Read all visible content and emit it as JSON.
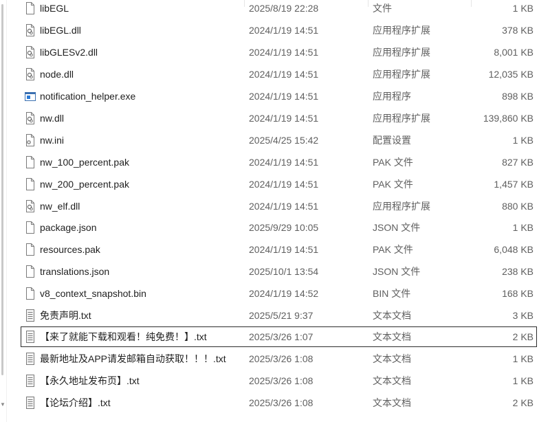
{
  "files": [
    {
      "name": "libEGL",
      "date": "2025/8/19 22:28",
      "type": "文件",
      "size": "1 KB",
      "icon": "blank-file-icon"
    },
    {
      "name": "libEGL.dll",
      "date": "2024/1/19 14:51",
      "type": "应用程序扩展",
      "size": "378 KB",
      "icon": "dll-file-icon"
    },
    {
      "name": "libGLESv2.dll",
      "date": "2024/1/19 14:51",
      "type": "应用程序扩展",
      "size": "8,001 KB",
      "icon": "dll-file-icon"
    },
    {
      "name": "node.dll",
      "date": "2024/1/19 14:51",
      "type": "应用程序扩展",
      "size": "12,035 KB",
      "icon": "dll-file-icon"
    },
    {
      "name": "notification_helper.exe",
      "date": "2024/1/19 14:51",
      "type": "应用程序",
      "size": "898 KB",
      "icon": "exe-file-icon"
    },
    {
      "name": "nw.dll",
      "date": "2024/1/19 14:51",
      "type": "应用程序扩展",
      "size": "139,860 KB",
      "icon": "dll-file-icon"
    },
    {
      "name": "nw.ini",
      "date": "2025/4/25 15:42",
      "type": "配置设置",
      "size": "1 KB",
      "icon": "ini-file-icon"
    },
    {
      "name": "nw_100_percent.pak",
      "date": "2024/1/19 14:51",
      "type": "PAK 文件",
      "size": "827 KB",
      "icon": "blank-file-icon"
    },
    {
      "name": "nw_200_percent.pak",
      "date": "2024/1/19 14:51",
      "type": "PAK 文件",
      "size": "1,457 KB",
      "icon": "blank-file-icon"
    },
    {
      "name": "nw_elf.dll",
      "date": "2024/1/19 14:51",
      "type": "应用程序扩展",
      "size": "880 KB",
      "icon": "dll-file-icon"
    },
    {
      "name": "package.json",
      "date": "2025/9/29 10:05",
      "type": "JSON 文件",
      "size": "1 KB",
      "icon": "blank-file-icon"
    },
    {
      "name": "resources.pak",
      "date": "2024/1/19 14:51",
      "type": "PAK 文件",
      "size": "6,048 KB",
      "icon": "blank-file-icon"
    },
    {
      "name": "translations.json",
      "date": "2025/10/1 13:54",
      "type": "JSON 文件",
      "size": "238 KB",
      "icon": "blank-file-icon"
    },
    {
      "name": "v8_context_snapshot.bin",
      "date": "2024/1/19 14:52",
      "type": "BIN 文件",
      "size": "168 KB",
      "icon": "blank-file-icon"
    },
    {
      "name": "免责声明.txt",
      "date": "2025/5/21 9:37",
      "type": "文本文档",
      "size": "3 KB",
      "icon": "text-file-icon"
    },
    {
      "name": "【来了就能下载和观看！纯免费！】.txt",
      "date": "2025/3/26 1:07",
      "type": "文本文档",
      "size": "2 KB",
      "icon": "text-file-icon",
      "selected": true
    },
    {
      "name": "最新地址及APP请发邮箱自动获取！！！.txt",
      "date": "2025/3/26 1:08",
      "type": "文本文档",
      "size": "1 KB",
      "icon": "text-file-icon"
    },
    {
      "name": "【永久地址发布页】.txt",
      "date": "2025/3/26 1:08",
      "type": "文本文档",
      "size": "1 KB",
      "icon": "text-file-icon"
    },
    {
      "name": "【论坛介绍】.txt",
      "date": "2025/3/26 1:08",
      "type": "文本文档",
      "size": "2 KB",
      "icon": "text-file-icon"
    }
  ]
}
